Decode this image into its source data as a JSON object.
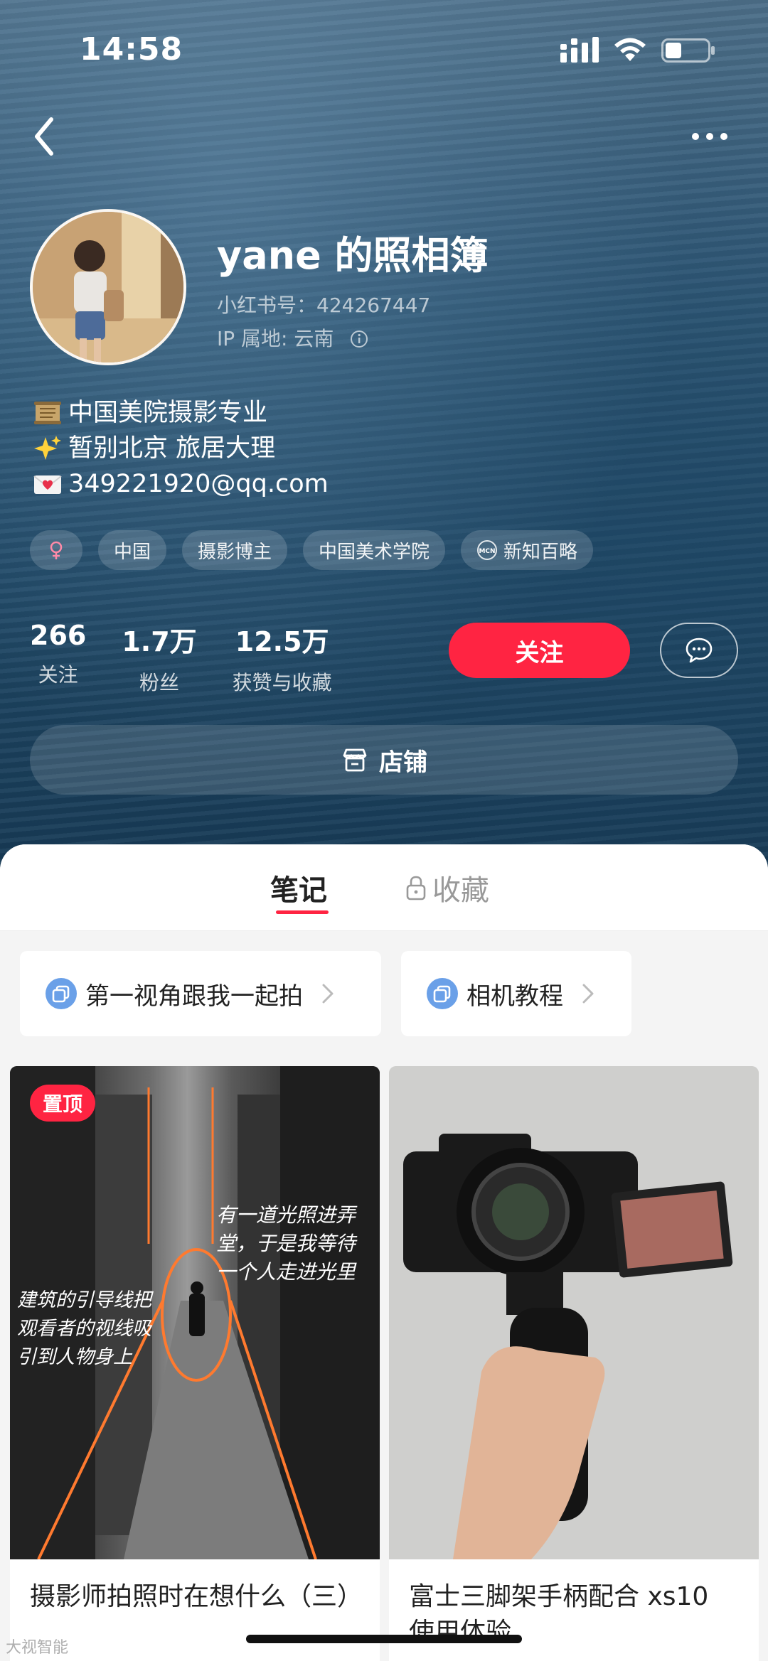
{
  "status_bar": {
    "time": "14:58"
  },
  "profile": {
    "nickname": "yane 的照相簿",
    "red_id": "小红书号：424267447",
    "ip_location": "IP 属地: 云南",
    "bio": [
      {
        "emoji": "scroll",
        "text": "中国美院摄影专业"
      },
      {
        "emoji": "sparkles",
        "text": "暂别北京 旅居大理"
      },
      {
        "emoji": "love-letter",
        "text": "349221920@qq.com"
      }
    ],
    "tags": [
      {
        "icon": "female-icon",
        "label": ""
      },
      {
        "icon": "",
        "label": "中国"
      },
      {
        "icon": "",
        "label": "摄影博主"
      },
      {
        "icon": "",
        "label": "中国美术学院"
      },
      {
        "icon": "mcn-icon",
        "label": "新知百略"
      }
    ],
    "stats": [
      {
        "value": "266",
        "label": "关注"
      },
      {
        "value": "1.7万",
        "label": "粉丝"
      },
      {
        "value": "12.5万",
        "label": "获赞与收藏"
      }
    ],
    "follow_label": "关注",
    "shop_label": "店铺"
  },
  "tabs": {
    "notes": "笔记",
    "collections": "收藏"
  },
  "collections": [
    {
      "label": "第一视角跟我一起拍"
    },
    {
      "label": "相机教程"
    }
  ],
  "notes": [
    {
      "pinned_label": "置顶",
      "title": "摄影师拍照时在想什么（三）",
      "cover_text_right": "有一道光照进弄堂，于是我等待一个人走进光里",
      "cover_text_left": "建筑的引导线把观看者的视线吸引到人物身上"
    },
    {
      "title": "富士三脚架手柄配合 xs10 使用体验"
    }
  ],
  "watermark": "大视智能",
  "colors": {
    "accent": "#ff2442",
    "hero_bg": "#1f4866"
  }
}
